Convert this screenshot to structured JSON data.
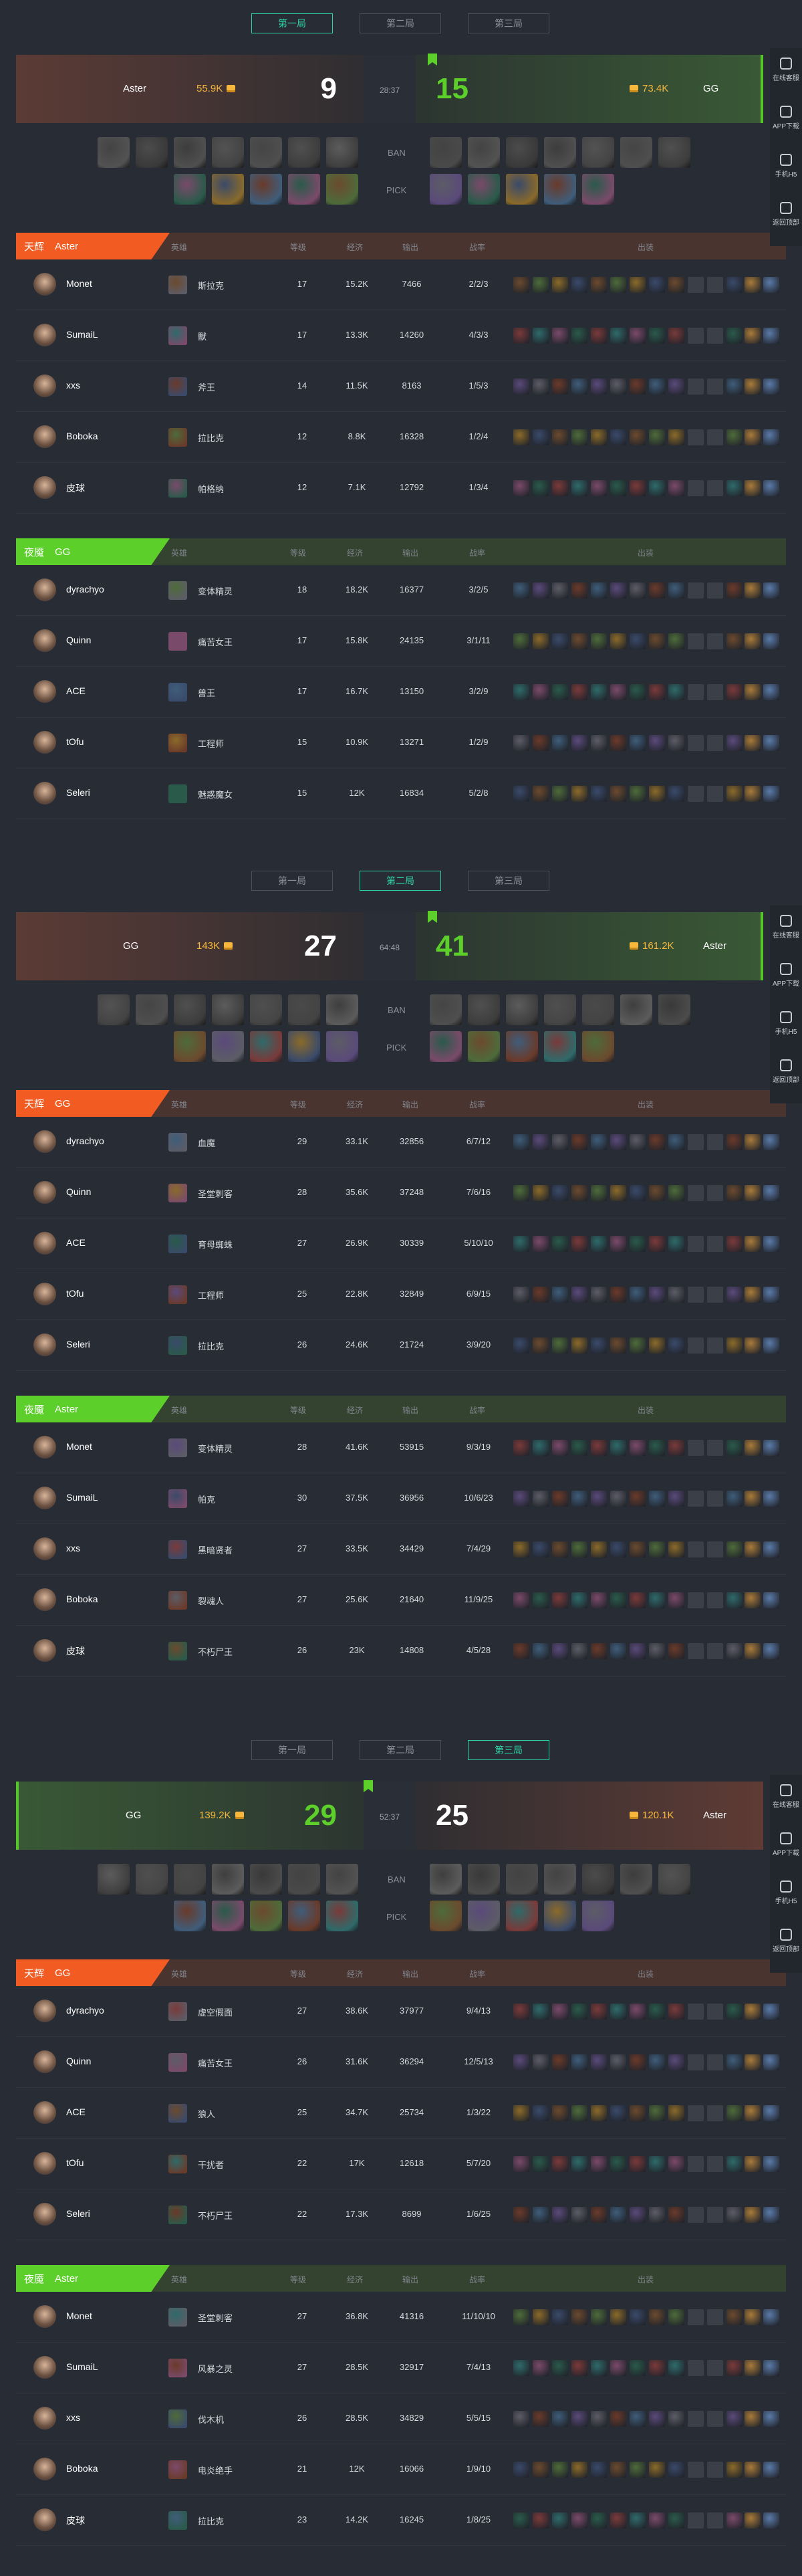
{
  "sidebar": {
    "items": [
      {
        "label": "在线客服",
        "icon": "headset-icon"
      },
      {
        "label": "APP下载",
        "icon": "qr-icon"
      },
      {
        "label": "手机H5",
        "icon": "phone-icon"
      },
      {
        "label": "返回顶部",
        "icon": "rocket-icon"
      }
    ]
  },
  "headers": {
    "side_radiant": "天辉",
    "side_dire": "夜魇",
    "hero": "英雄",
    "level": "等级",
    "gold": "经济",
    "damage": "输出",
    "kda": "战率",
    "items": "出装",
    "ban": "BAN",
    "pick": "PICK"
  },
  "colors": {
    "radiant": "#f25c23",
    "dire": "#5dcf2b",
    "win": "#5dcf2b",
    "gold": "#f6b73c",
    "accent": "#2fd3a8"
  },
  "games": [
    {
      "tabs": [
        "第一局",
        "第二局",
        "第三局"
      ],
      "active_tab": 0,
      "score": {
        "left_team": "Aster",
        "left_gold": "55.9K",
        "left_kills": "9",
        "time": "28:37",
        "right_kills": "15",
        "right_gold": "73.4K",
        "right_team": "GG",
        "winner": "right"
      },
      "sections": [
        {
          "side": "radiant",
          "team": "Aster",
          "players": [
            {
              "name": "Monet",
              "hero": "斯拉克",
              "level": "17",
              "gold": "15.2K",
              "damage": "7466",
              "kda": "2/2/3"
            },
            {
              "name": "SumaiL",
              "hero": "獸",
              "level": "17",
              "gold": "13.3K",
              "damage": "14260",
              "kda": "4/3/3"
            },
            {
              "name": "xxs",
              "hero": "斧王",
              "level": "14",
              "gold": "11.5K",
              "damage": "8163",
              "kda": "1/5/3"
            },
            {
              "name": "Boboka",
              "hero": "拉比克",
              "level": "12",
              "gold": "8.8K",
              "damage": "16328",
              "kda": "1/2/4"
            },
            {
              "name": "皮球",
              "hero": "帕格纳",
              "level": "12",
              "gold": "7.1K",
              "damage": "12792",
              "kda": "1/3/4"
            }
          ]
        },
        {
          "side": "dire",
          "team": "GG",
          "players": [
            {
              "name": "dyrachyo",
              "hero": "变体精灵",
              "level": "18",
              "gold": "18.2K",
              "damage": "16377",
              "kda": "3/2/5"
            },
            {
              "name": "Quinn",
              "hero": "痛苦女王",
              "level": "17",
              "gold": "15.8K",
              "damage": "24135",
              "kda": "3/1/11"
            },
            {
              "name": "ACE",
              "hero": "兽王",
              "level": "17",
              "gold": "16.7K",
              "damage": "13150",
              "kda": "3/2/9"
            },
            {
              "name": "tOfu",
              "hero": "工程师",
              "level": "15",
              "gold": "10.9K",
              "damage": "13271",
              "kda": "1/2/9"
            },
            {
              "name": "Seleri",
              "hero": "魅惑魔女",
              "level": "15",
              "gold": "12K",
              "damage": "16834",
              "kda": "5/2/8"
            }
          ]
        }
      ]
    },
    {
      "tabs": [
        "第一局",
        "第二局",
        "第三局"
      ],
      "active_tab": 1,
      "score": {
        "left_team": "GG",
        "left_gold": "143K",
        "left_kills": "27",
        "time": "64:48",
        "right_kills": "41",
        "right_gold": "161.2K",
        "right_team": "Aster",
        "winner": "right"
      },
      "sections": [
        {
          "side": "radiant",
          "team": "GG",
          "players": [
            {
              "name": "dyrachyo",
              "hero": "血魔",
              "level": "29",
              "gold": "33.1K",
              "damage": "32856",
              "kda": "6/7/12"
            },
            {
              "name": "Quinn",
              "hero": "圣堂刺客",
              "level": "28",
              "gold": "35.6K",
              "damage": "37248",
              "kda": "7/6/16"
            },
            {
              "name": "ACE",
              "hero": "育母蜘蛛",
              "level": "27",
              "gold": "26.9K",
              "damage": "30339",
              "kda": "5/10/10"
            },
            {
              "name": "tOfu",
              "hero": "工程师",
              "level": "25",
              "gold": "22.8K",
              "damage": "32849",
              "kda": "6/9/15"
            },
            {
              "name": "Seleri",
              "hero": "拉比克",
              "level": "26",
              "gold": "24.6K",
              "damage": "21724",
              "kda": "3/9/20"
            }
          ]
        },
        {
          "side": "dire",
          "team": "Aster",
          "players": [
            {
              "name": "Monet",
              "hero": "变体精灵",
              "level": "28",
              "gold": "41.6K",
              "damage": "53915",
              "kda": "9/3/19"
            },
            {
              "name": "SumaiL",
              "hero": "帕克",
              "level": "30",
              "gold": "37.5K",
              "damage": "36956",
              "kda": "10/6/23"
            },
            {
              "name": "xxs",
              "hero": "黑暗贤者",
              "level": "27",
              "gold": "33.5K",
              "damage": "34429",
              "kda": "7/4/29"
            },
            {
              "name": "Boboka",
              "hero": "裂魂人",
              "level": "27",
              "gold": "25.6K",
              "damage": "21640",
              "kda": "11/9/25"
            },
            {
              "name": "皮球",
              "hero": "不朽尸王",
              "level": "26",
              "gold": "23K",
              "damage": "14808",
              "kda": "4/5/28"
            }
          ]
        }
      ]
    },
    {
      "tabs": [
        "第一局",
        "第二局",
        "第三局"
      ],
      "active_tab": 2,
      "score": {
        "left_team": "GG",
        "left_gold": "139.2K",
        "left_kills": "29",
        "time": "52:37",
        "right_kills": "25",
        "right_gold": "120.1K",
        "right_team": "Aster",
        "winner": "left"
      },
      "sections": [
        {
          "side": "radiant",
          "team": "GG",
          "players": [
            {
              "name": "dyrachyo",
              "hero": "虚空假面",
              "level": "27",
              "gold": "38.6K",
              "damage": "37977",
              "kda": "9/4/13"
            },
            {
              "name": "Quinn",
              "hero": "痛苦女王",
              "level": "26",
              "gold": "31.6K",
              "damage": "36294",
              "kda": "12/5/13"
            },
            {
              "name": "ACE",
              "hero": "狼人",
              "level": "25",
              "gold": "34.7K",
              "damage": "25734",
              "kda": "1/3/22"
            },
            {
              "name": "tOfu",
              "hero": "干扰者",
              "level": "22",
              "gold": "17K",
              "damage": "12618",
              "kda": "5/7/20"
            },
            {
              "name": "Seleri",
              "hero": "不朽尸王",
              "level": "22",
              "gold": "17.3K",
              "damage": "8699",
              "kda": "1/6/25"
            }
          ]
        },
        {
          "side": "dire",
          "team": "Aster",
          "players": [
            {
              "name": "Monet",
              "hero": "圣堂刺客",
              "level": "27",
              "gold": "36.8K",
              "damage": "41316",
              "kda": "11/10/10"
            },
            {
              "name": "SumaiL",
              "hero": "风暴之灵",
              "level": "27",
              "gold": "28.5K",
              "damage": "32917",
              "kda": "7/4/13"
            },
            {
              "name": "xxs",
              "hero": "伐木机",
              "level": "26",
              "gold": "28.5K",
              "damage": "34829",
              "kda": "5/5/15"
            },
            {
              "name": "Boboka",
              "hero": "电炎绝手",
              "level": "21",
              "gold": "12K",
              "damage": "16066",
              "kda": "1/9/10"
            },
            {
              "name": "皮球",
              "hero": "拉比克",
              "level": "23",
              "gold": "14.2K",
              "damage": "16245",
              "kda": "1/8/25"
            }
          ]
        }
      ]
    }
  ]
}
